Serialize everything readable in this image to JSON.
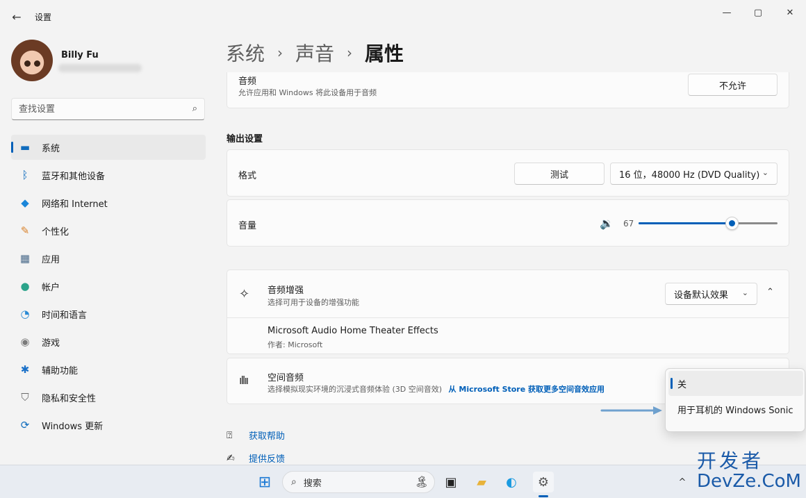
{
  "window": {
    "title": "设置",
    "back_icon": "←",
    "minimize_icon": "—",
    "maximize_icon": "▢",
    "close_icon": "✕"
  },
  "profile": {
    "name": "Billy Fu"
  },
  "search": {
    "placeholder": "查找设置",
    "icon": "⌕"
  },
  "sidebar": {
    "items": [
      {
        "label": "系统",
        "icon": "▬",
        "color": "#0f6cbd",
        "active": true
      },
      {
        "label": "蓝牙和其他设备",
        "icon": "ᛒ",
        "color": "#0f6cbd"
      },
      {
        "label": "网络和 Internet",
        "icon": "◆",
        "color": "#1a86d9"
      },
      {
        "label": "个性化",
        "icon": "✎",
        "color": "#d9822b"
      },
      {
        "label": "应用",
        "icon": "▦",
        "color": "#4a6a8a"
      },
      {
        "label": "帐户",
        "icon": "●",
        "color": "#2ba38a"
      },
      {
        "label": "时间和语言",
        "icon": "◔",
        "color": "#2a8ad4"
      },
      {
        "label": "游戏",
        "icon": "◉",
        "color": "#7a7a7a"
      },
      {
        "label": "辅助功能",
        "icon": "✱",
        "color": "#1a70c8"
      },
      {
        "label": "隐私和安全性",
        "icon": "⛉",
        "color": "#6a6a6a"
      },
      {
        "label": "Windows 更新",
        "icon": "⟳",
        "color": "#0f6cbd"
      }
    ]
  },
  "breadcrumb": {
    "items": [
      "系统",
      "声音"
    ],
    "current": "属性",
    "separator": "›"
  },
  "audio_card": {
    "title": "音频",
    "subtitle": "允许应用和 Windows 将此设备用于音频",
    "button": "不允许"
  },
  "output_settings": {
    "header": "输出设置",
    "format": {
      "label": "格式",
      "test_button": "测试",
      "selected": "16 位，48000 Hz (DVD Quality)",
      "chevron": "⌄"
    },
    "volume": {
      "label": "音量",
      "value": "67",
      "fraction": 0.67,
      "icon": "🔉"
    }
  },
  "enhancement": {
    "title": "音频增强",
    "subtitle": "选择可用于设备的增强功能",
    "dropdown": "设备默认效果",
    "chevron": "⌄",
    "collapse_icon": "⌃",
    "effect_name": "Microsoft Audio Home Theater Effects",
    "effect_author": "作者: Microsoft"
  },
  "spatial": {
    "title": "空间音频",
    "subtitle": "选择模拟现实环境的沉浸式音频体验 (3D 空间音效)",
    "link": "从 Microsoft Store 获取更多空间音效应用",
    "options": [
      "关",
      "用于耳机的 Windows Sonic"
    ],
    "selected_index": 0
  },
  "help": {
    "get_help": "获取帮助",
    "feedback": "提供反馈"
  },
  "taskbar": {
    "search_label": "搜索",
    "search_icon": "⌕",
    "start_icon": "⊞",
    "tray_chevron": "^"
  },
  "watermark": {
    "line1": "开发者",
    "line2": "DevZe.CoM"
  },
  "colors": {
    "accent": "#005fb8",
    "background": "#f3f3f3",
    "card": "#fbfbfb"
  }
}
